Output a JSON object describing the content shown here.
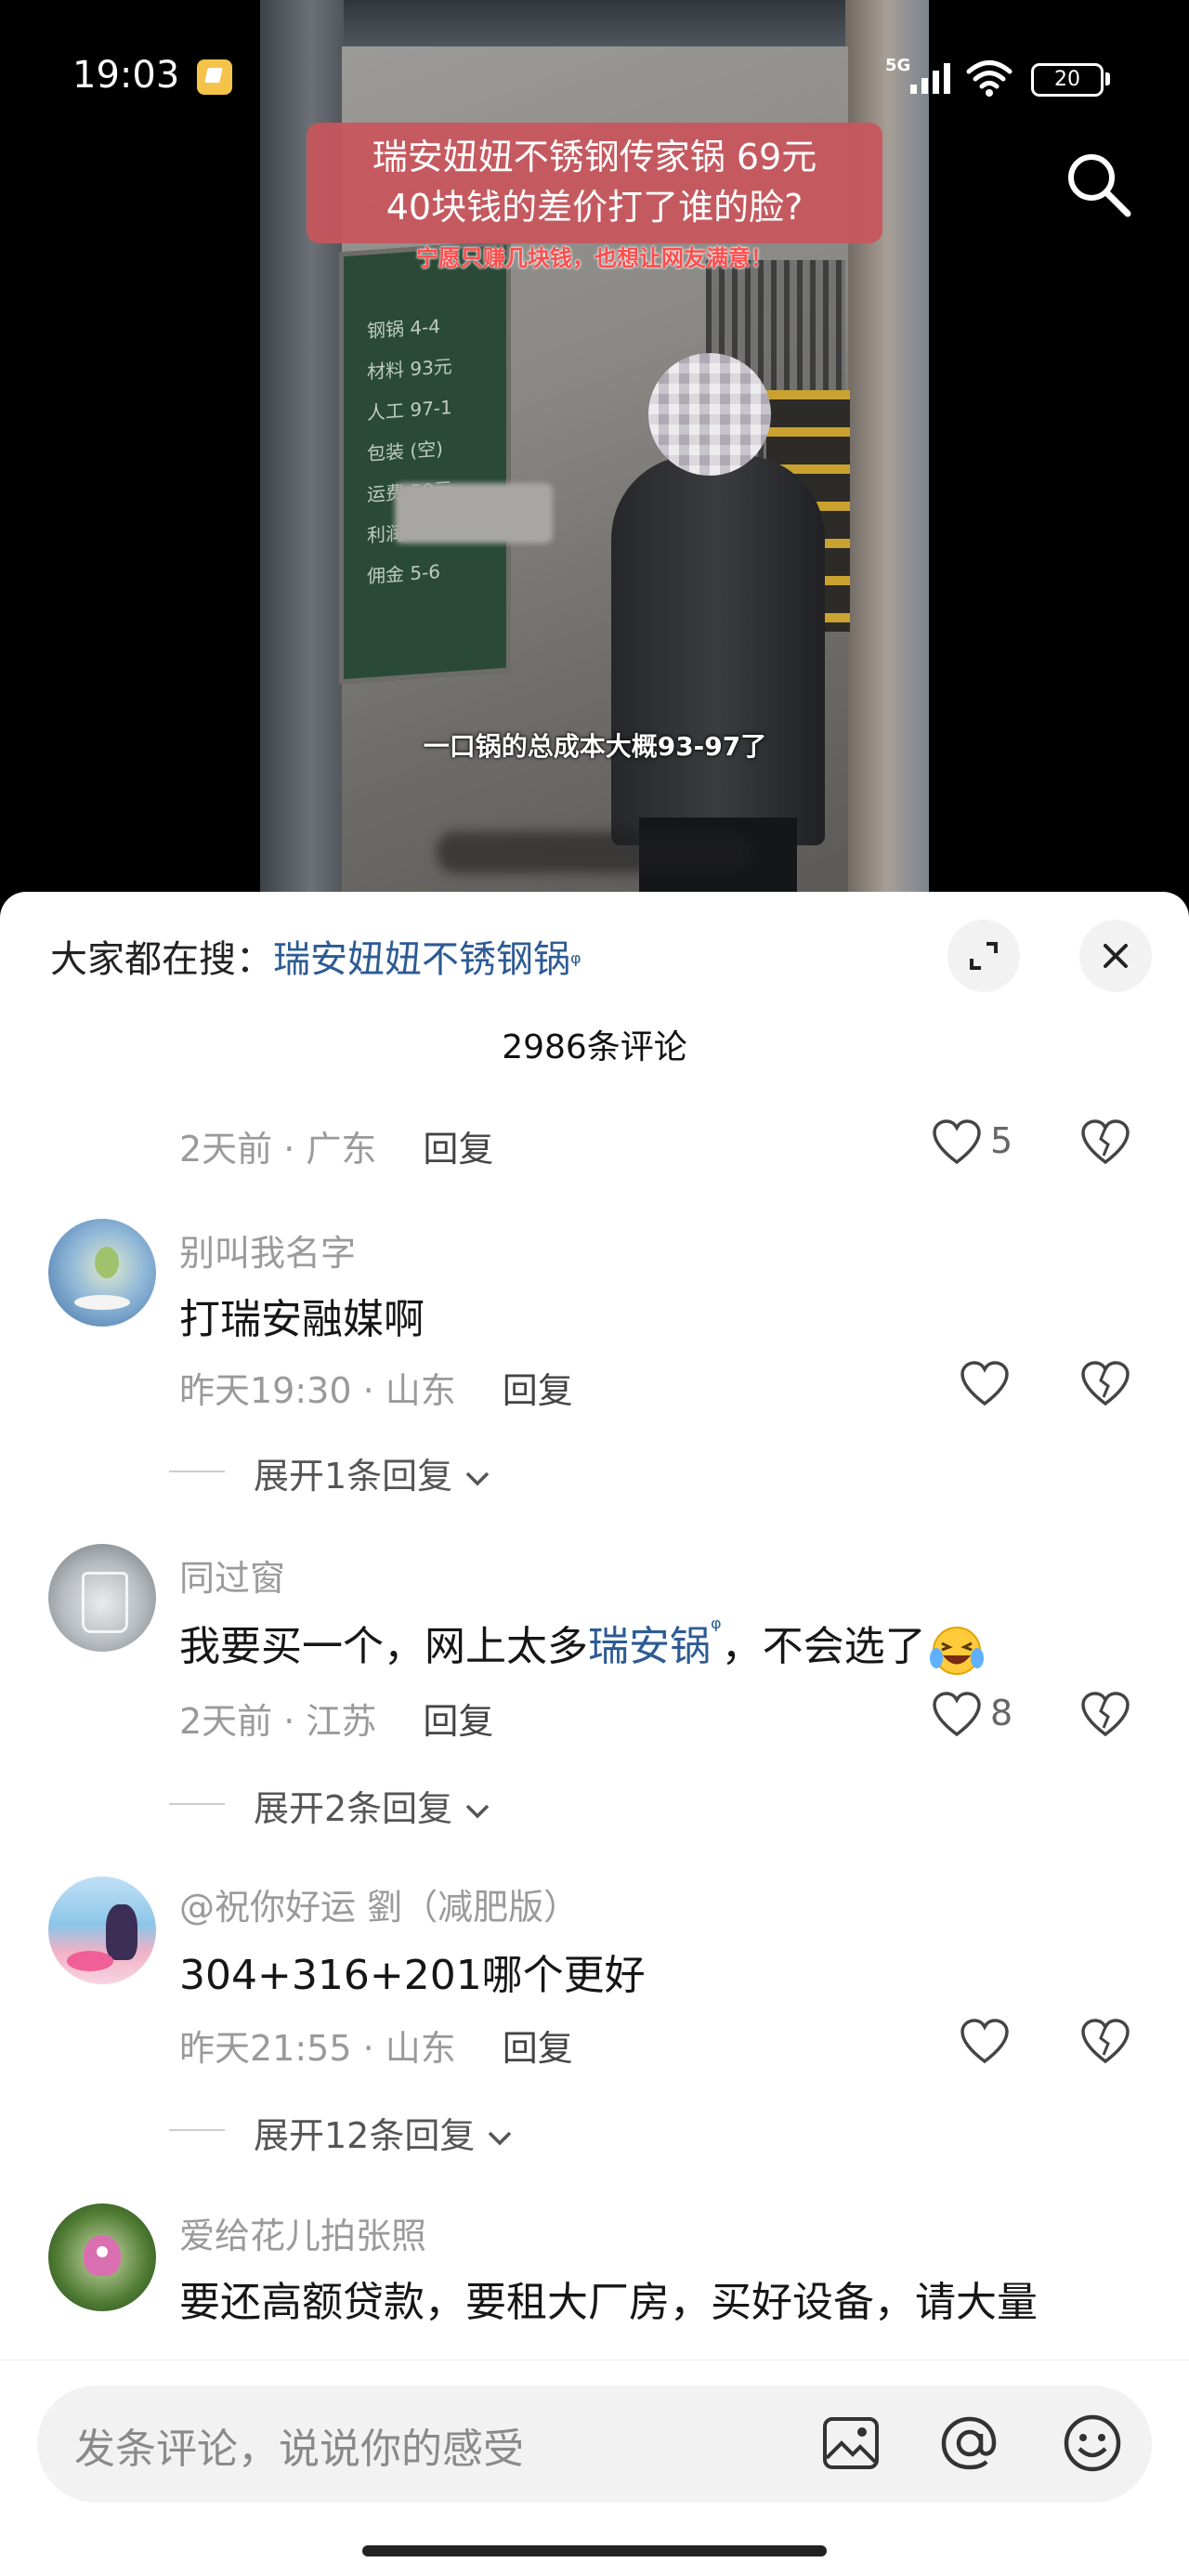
{
  "status_bar": {
    "time": "19:03",
    "network": "5G",
    "battery": "20"
  },
  "video": {
    "title_line1": "瑞安妞妞不锈钢传家锅 69元",
    "title_line2": "40块钱的差价打了谁的脸?",
    "subtitle": "宁愿只赚几块钱，也想让网友满意！",
    "caption": "一口锅的总成本大概93-97了",
    "board_lines": [
      "钢锅 4-4",
      "材料 93元",
      "人工 97-1",
      "包装 (空)",
      "运费 50元",
      "利润",
      "佣金 5-6"
    ]
  },
  "hot_search": {
    "label": "大家都在搜：",
    "keyword": "瑞安妞妞不锈钢锅",
    "mag": "ᵠ"
  },
  "comments_count": "2986条评论",
  "comments": [
    {
      "meta_time": "2天前 · 广东",
      "reply": "回复",
      "likes": "5"
    },
    {
      "name": "别叫我名字",
      "text": "打瑞安融媒啊",
      "meta_time": "昨天19:30 · 山东",
      "reply": "回复",
      "likes": "",
      "expand": "展开1条回复"
    },
    {
      "name": "同过窗",
      "text_pre": "我要买一个，网上太多",
      "text_link": "瑞安锅",
      "text_post": "，不会选了",
      "meta_time": "2天前 · 江苏",
      "reply": "回复",
      "likes": "8",
      "expand": "展开2条回复"
    },
    {
      "name": "@祝你好运 劉（减肥版）",
      "text": "304+316+201哪个更好",
      "meta_time": "昨天21:55 · 山东",
      "reply": "回复",
      "likes": "",
      "expand": "展开12条回复"
    },
    {
      "name": "爱给花儿拍张照",
      "text": "要还高额贷款，要租大厂房，买好设备，请大量"
    }
  ],
  "input": {
    "placeholder": "发条评论，说说你的感受"
  },
  "colors": {
    "link": "#2d5b94",
    "banner": "#c8565c"
  }
}
